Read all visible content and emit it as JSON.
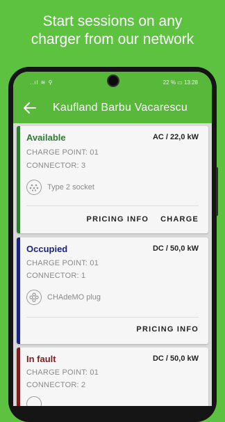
{
  "promo": {
    "line1": "Start sessions on any",
    "line2": "charger from our network"
  },
  "status_bar": {
    "signal": "..ıl ≋ ⚲",
    "battery_text": "22 % ▭ 13:28"
  },
  "app_bar": {
    "title": "Kaufland Barbu Vacarescu"
  },
  "connectors": [
    {
      "status": "Available",
      "status_color": "#2e7d32",
      "power": "AC / 22,0 kW",
      "charge_point": "CHARGE POINT: 01",
      "connector": "CONNECTOR: 3",
      "plug": "Type 2 socket",
      "actions": [
        "PRICING INFO",
        "CHARGE"
      ]
    },
    {
      "status": "Occupied",
      "status_color": "#1a237e",
      "power": "DC / 50,0 kW",
      "charge_point": "CHARGE POINT: 01",
      "connector": "CONNECTOR: 1",
      "plug": "CHAdeMO plug",
      "actions": [
        "PRICING INFO"
      ]
    },
    {
      "status": "In fault",
      "status_color": "#7b1e1e",
      "power": "DC / 50,0 kW",
      "charge_point": "CHARGE POINT: 01",
      "connector": "CONNECTOR: 2"
    }
  ]
}
